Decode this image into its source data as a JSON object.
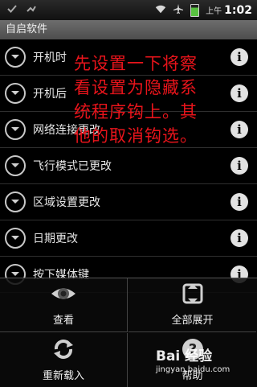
{
  "status_bar": {
    "ampm": "上午",
    "time": "1:02",
    "icons": [
      "check-icon",
      "sync-icon",
      "wifi-icon",
      "airplane-icon",
      "battery-icon"
    ]
  },
  "title_bar": {
    "title": "自启软件"
  },
  "list": {
    "items": [
      {
        "label": "开机时"
      },
      {
        "label": "开机后"
      },
      {
        "label": "网络连接更改"
      },
      {
        "label": "飞行模式已更改"
      },
      {
        "label": "区域设置更改"
      },
      {
        "label": "日期更改"
      },
      {
        "label": "按下媒体键"
      }
    ]
  },
  "annotation": {
    "lines": [
      "先设置一下将察",
      "看设置为隐藏系",
      "统程序钩上。其",
      "他的取消钩选。"
    ],
    "color": "#e8141b"
  },
  "menu": {
    "view": "查看",
    "expand_all": "全部展开",
    "reload": "重新载入",
    "help": "帮助"
  },
  "watermark": {
    "logo": "Bai 经验",
    "url": "jingyan.baidu.com"
  }
}
